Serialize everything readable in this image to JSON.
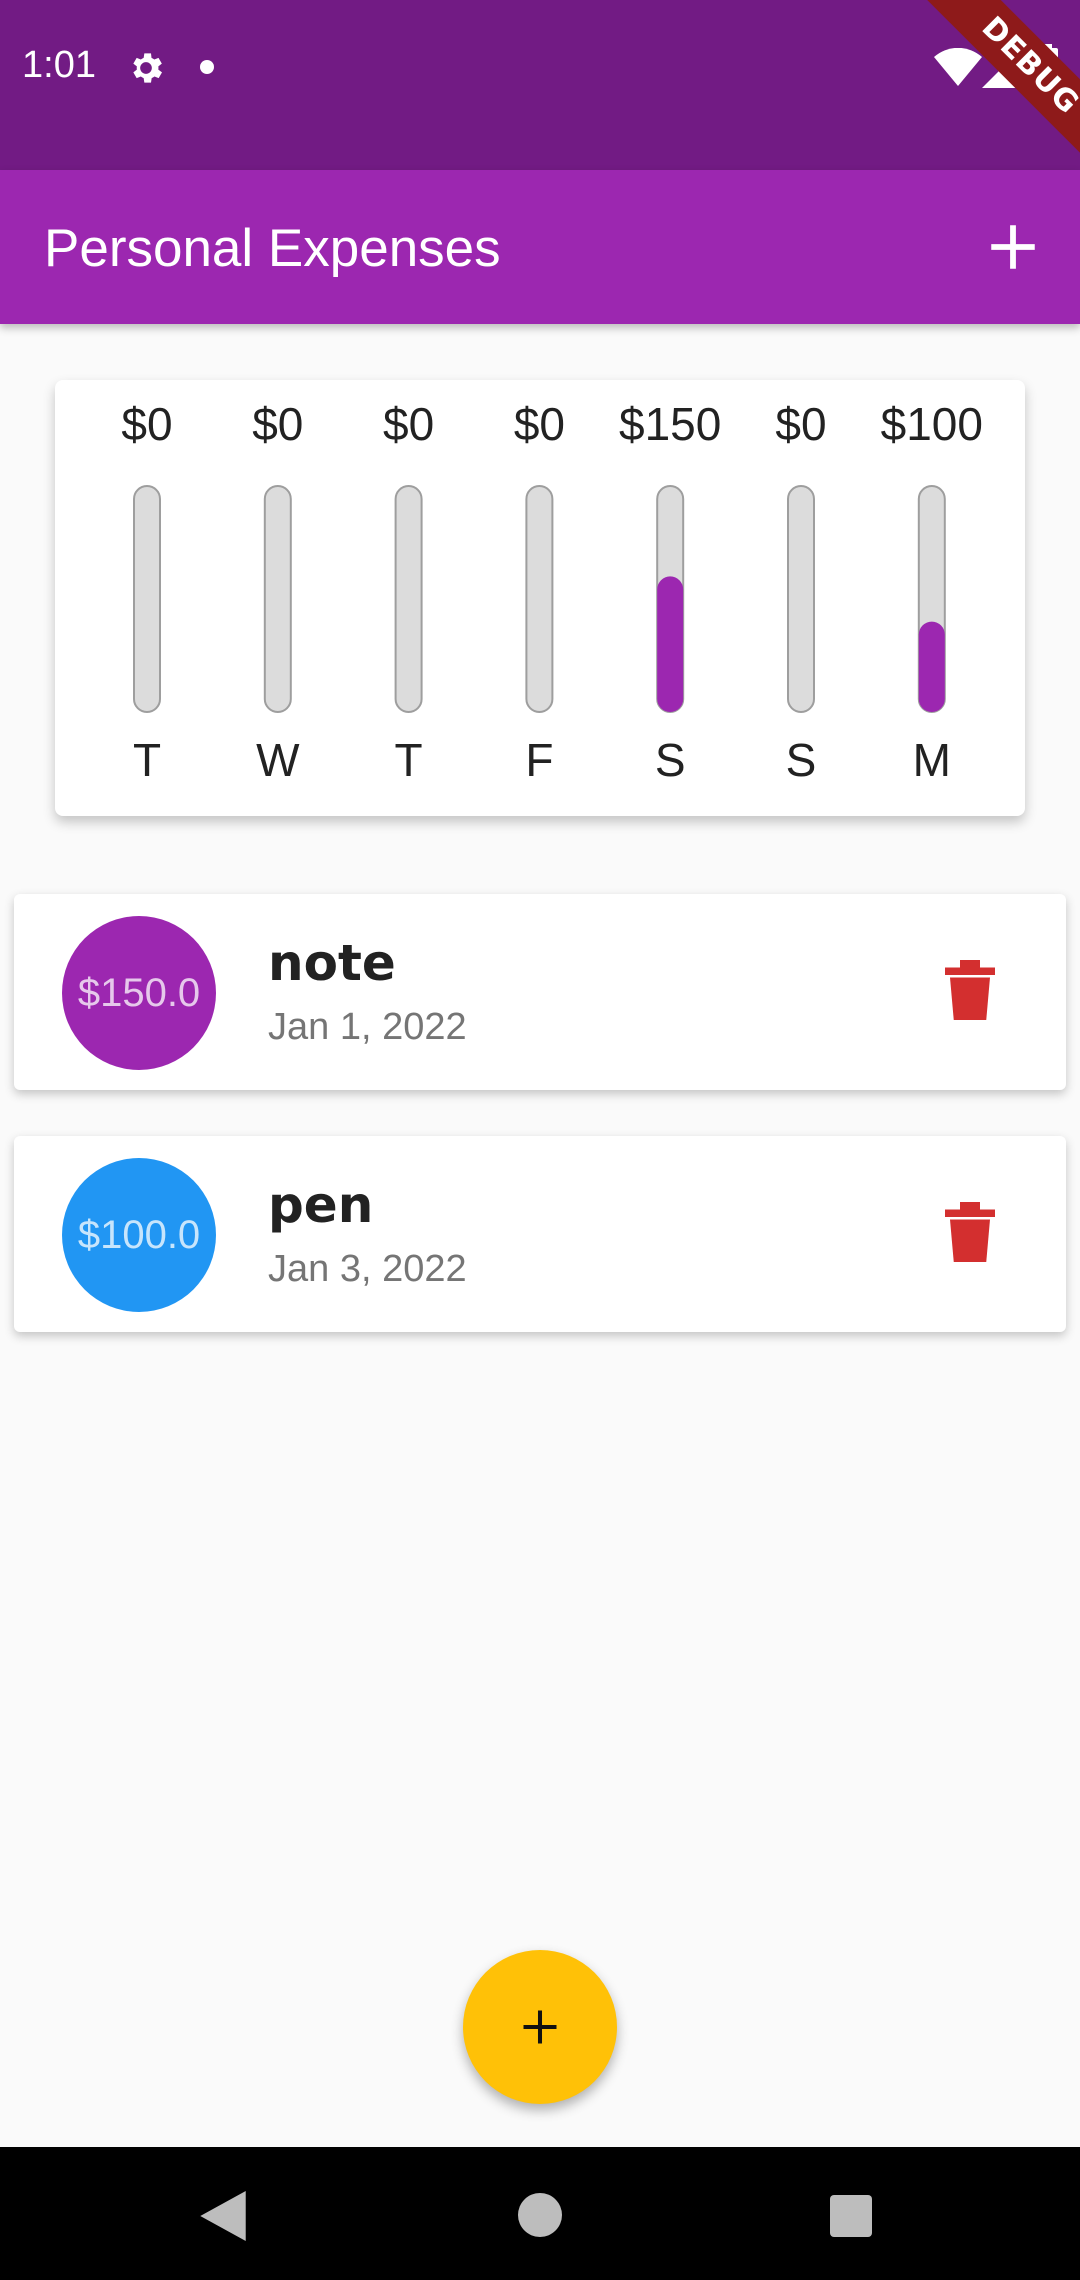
{
  "status_bar": {
    "time": "1:01",
    "icons": [
      "gear-icon",
      "dot-icon",
      "wifi-icon",
      "signal-icon",
      "battery-icon"
    ],
    "debug_banner": "DEBUG"
  },
  "app_bar": {
    "title": "Personal Expenses",
    "add_icon": "plus-icon"
  },
  "colors": {
    "status_bar": "#721b84",
    "primary": "#9c27b0",
    "accent": "#ffc107",
    "bar_track": "#dcdcdc",
    "delete": "#d32f2f",
    "avatar_note": "#9c27b0",
    "avatar_pen": "#2196f3"
  },
  "chart_data": {
    "type": "bar",
    "categories": [
      "T",
      "W",
      "T",
      "F",
      "S",
      "S",
      "M"
    ],
    "value_labels": [
      "$0",
      "$0",
      "$0",
      "$0",
      "$150",
      "$0",
      "$100"
    ],
    "values": [
      0,
      0,
      0,
      0,
      150,
      0,
      100
    ],
    "ylim": [
      0,
      250
    ]
  },
  "transactions": [
    {
      "amount": "$150.0",
      "title": "note",
      "date": "Jan 1, 2022",
      "avatar_color": "#9c27b0",
      "delete_icon": "trash-icon"
    },
    {
      "amount": "$100.0",
      "title": "pen",
      "date": "Jan 3, 2022",
      "avatar_color": "#2196f3",
      "delete_icon": "trash-icon"
    }
  ],
  "fab": {
    "icon": "plus-icon"
  },
  "nav_bar": {
    "icons": [
      "back-icon",
      "home-icon",
      "recents-icon"
    ]
  }
}
